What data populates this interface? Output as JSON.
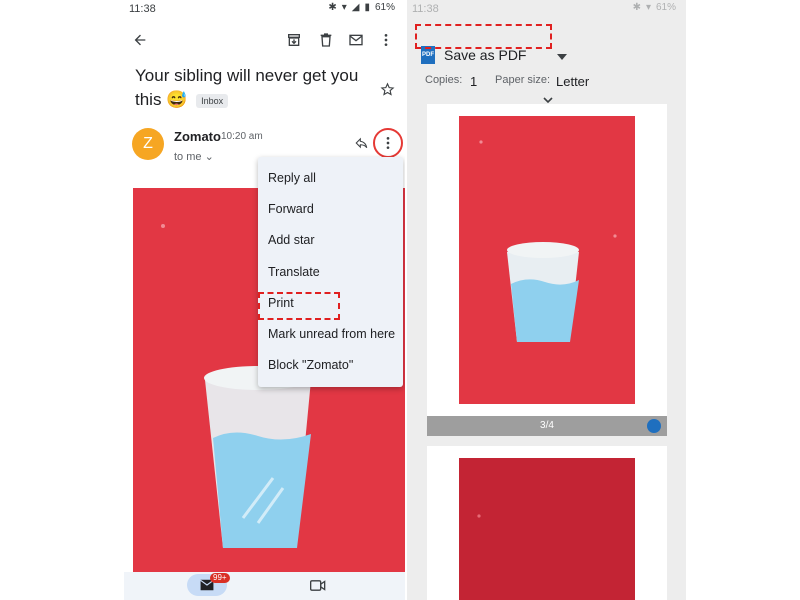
{
  "left_screen": {
    "status": {
      "time": "11:38",
      "battery": "61%"
    },
    "subject": "Your sibling will never get you this 😅",
    "label": "Inbox",
    "sender": {
      "initial": "Z",
      "name": "Zomato",
      "time": "10:20 am",
      "recipient": "to me"
    },
    "menu": [
      "Reply all",
      "Forward",
      "Add star",
      "Translate",
      "Print",
      "Mark unread from here",
      "Block \"Zomato\""
    ],
    "nav_badge": "99+",
    "icons": [
      "back-arrow-icon",
      "archive-icon",
      "delete-icon",
      "mail-icon",
      "more-vert-icon",
      "star-icon",
      "reply-icon",
      "chevron-down-icon",
      "mail-icon",
      "video-icon"
    ]
  },
  "right_screen": {
    "status": {
      "time": "11:38",
      "battery": "61%"
    },
    "printer": "Save as PDF",
    "copies_label": "Copies:",
    "copies_value": "1",
    "paper_label": "Paper size:",
    "paper_value": "Letter",
    "page_indicator": "3/4",
    "icons": [
      "pdf-icon",
      "dropdown-arrow-icon",
      "chevron-down-icon",
      "check-circle-icon"
    ]
  },
  "colors": {
    "accent_red": "#e23744",
    "highlight": "#e02020",
    "avatar": "#f6a623",
    "menu_bg": "#eef2f8",
    "pdf_blue": "#1f6fbf"
  }
}
